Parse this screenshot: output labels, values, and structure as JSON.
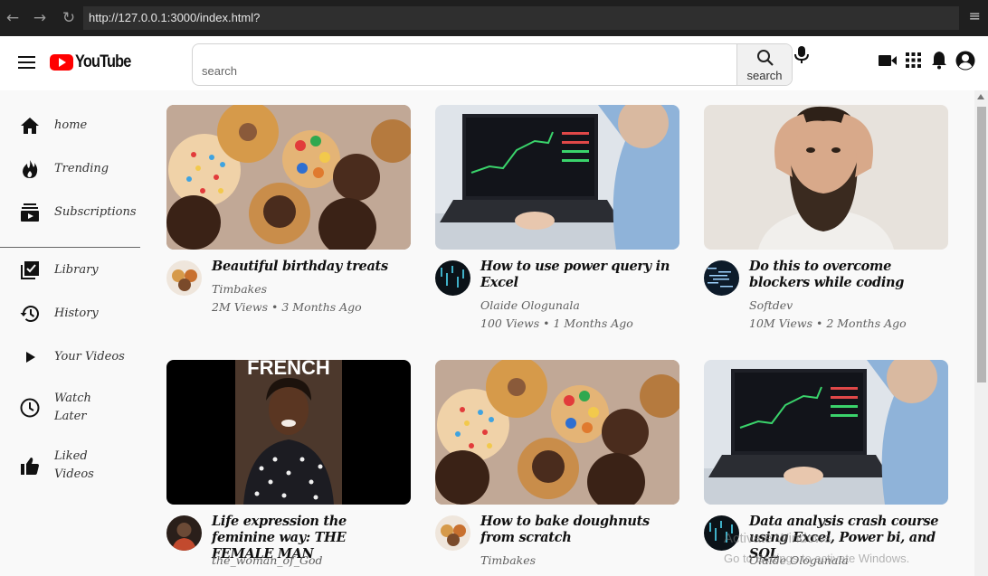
{
  "browser": {
    "url": "http://127.0.0.1:3000/index.html?"
  },
  "header": {
    "logo_text": "YouTube",
    "search_placeholder": "search",
    "search_button_label": "search"
  },
  "sidebar": {
    "items": [
      {
        "label": "home",
        "icon": "home-icon"
      },
      {
        "label": "Trending",
        "icon": "fire-icon"
      },
      {
        "label": "Subscriptions",
        "icon": "subscriptions-icon"
      },
      {
        "label": "Library",
        "icon": "library-icon"
      },
      {
        "label": "History",
        "icon": "history-icon"
      },
      {
        "label": "Your Videos",
        "icon": "play-icon"
      },
      {
        "label": "Watch Later",
        "icon": "clock-icon"
      },
      {
        "label": "Liked Videos",
        "icon": "thumbs-up-icon"
      }
    ]
  },
  "videos": [
    {
      "title": "Beautiful birthday treats",
      "channel": "Timbakes",
      "views": "2M Views",
      "age": "3 Months Ago"
    },
    {
      "title": "How to use power query in Excel",
      "channel": "Olaide Ologunala",
      "views": "100 Views",
      "age": "1 Months Ago"
    },
    {
      "title": "Do this to overcome blockers while coding",
      "channel": "Softdev",
      "views": "10M Views",
      "age": "2 Months Ago"
    },
    {
      "title": "Life expression the feminine way: THE FEMALE MAN",
      "channel": "the_woman_of_God",
      "views": "",
      "age": ""
    },
    {
      "title": "How to bake doughnuts from scratch",
      "channel": "Timbakes",
      "views": "",
      "age": ""
    },
    {
      "title": "Data analysis crash course using Excel, Power bi, and SQL",
      "channel": "Olaide Ologunala",
      "views": "",
      "age": ""
    }
  ],
  "thumbnail_text": {
    "french": "FRENCH"
  },
  "watermark": {
    "line1": "Activate Windows",
    "line2": "Go to Settings to activate Windows."
  },
  "colors": {
    "brand_red": "#ff0000"
  }
}
